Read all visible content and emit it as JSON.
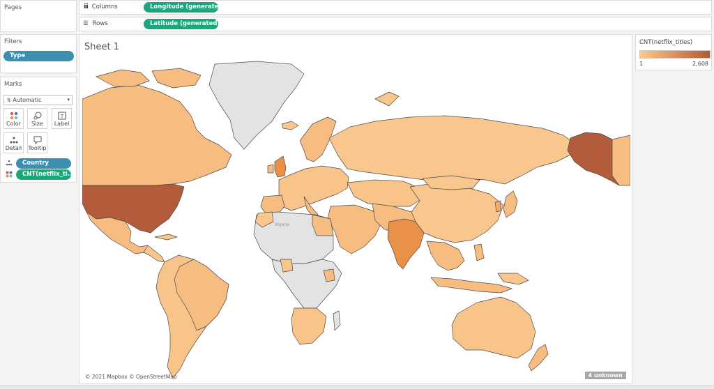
{
  "pages": {
    "title": "Pages"
  },
  "shelves": {
    "columns": {
      "label": "Columns",
      "pill": "Longitude (generated)"
    },
    "rows": {
      "label": "Rows",
      "pill": "Latitude (generated)"
    }
  },
  "filters": {
    "title": "Filters",
    "items": [
      "Type"
    ]
  },
  "marks": {
    "title": "Marks",
    "type": "Automatic",
    "buttons": {
      "color": "Color",
      "size": "Size",
      "label": "Label",
      "detail": "Detail",
      "tooltip": "Tooltip"
    },
    "fields": {
      "detail": "Country",
      "color": "CNT(netflix_ti..."
    }
  },
  "sheet": {
    "title": "Sheet 1",
    "attribution": "© 2021 Mapbox © OpenStreetMap",
    "unknown_badge": "4 unknown",
    "map_labels": {
      "algeria": "Algeria"
    }
  },
  "legend": {
    "title": "CNT(netflix_titles)",
    "min": "1",
    "max": "2,608",
    "colors": {
      "low": "#fcc98a",
      "high": "#b45a35"
    }
  },
  "colors": {
    "no_data": "#e3e3e3",
    "light": "#f9c78e",
    "mid": "#f3ad70",
    "india": "#ea9148",
    "usa": "#b25c3b",
    "ocean": "#ffffff",
    "pill_green": "#1ba77c",
    "pill_blue": "#3d8fb0"
  }
}
